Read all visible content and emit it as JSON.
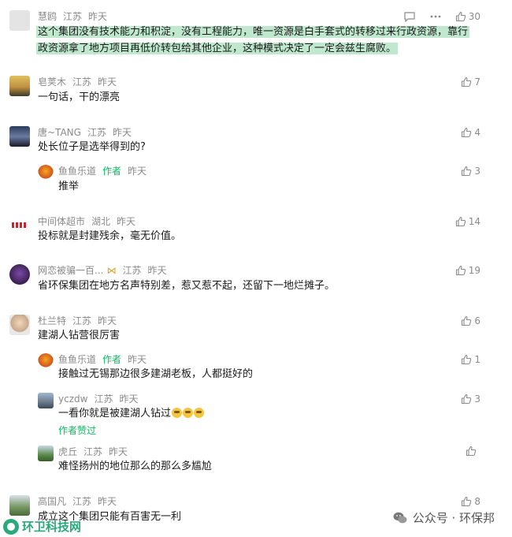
{
  "comments": [
    {
      "name": "慧鸥",
      "region": "江苏",
      "time": "昨天",
      "lines": [
        "这个集团没有技术能力和积淀，没有工程能力，唯一资源是白手套式的转移过来行政资源，靠行",
        "政资源拿了地方项目再低价转包给其他企业，这种模式决定了一定会兹生腐败。"
      ],
      "likes": "30"
    },
    {
      "name": "皂荚木",
      "region": "江苏",
      "time": "昨天",
      "text": "一句话，干的漂亮",
      "likes": "7"
    },
    {
      "name": "唐~TANG",
      "region": "江苏",
      "time": "昨天",
      "text": "处长位子是选举得到的?",
      "likes": "4"
    },
    {
      "name": "鱼鱼乐道",
      "tag": "作者",
      "time": "昨天",
      "text": "推举",
      "likes": "3"
    },
    {
      "name": "中间体超市",
      "region": "湖北",
      "time": "昨天",
      "text": "投标就是封建残余，毫无价值。",
      "likes": "14"
    },
    {
      "name": "网恋被骗一百...",
      "region": "江苏",
      "time": "昨天",
      "text": "省环保集团在地方名声特别差，惹又惹不起，还留下一地烂摊子。",
      "likes": "19"
    },
    {
      "name": "杜兰特",
      "region": "江苏",
      "time": "昨天",
      "text": "建湖人钻营很厉害",
      "likes": "6"
    },
    {
      "name": "鱼鱼乐道",
      "tag": "作者",
      "time": "昨天",
      "text": "接触过无锡那边很多建湖老板，人都挺好的",
      "likes": "1"
    },
    {
      "name": "yczdw",
      "region": "江苏",
      "time": "昨天",
      "text": "一看你就是被建湖人钻过",
      "sub": "作者赞过",
      "likes": "3"
    },
    {
      "name": "虎丘",
      "region": "江苏",
      "time": "昨天",
      "text": "难怪扬州的地位那么的那么多尴尬",
      "likes": ""
    },
    {
      "name": "高国凡",
      "region": "江苏",
      "time": "昨天",
      "text": "成立这个集团只能有百害无一利",
      "likes": "8"
    }
  ],
  "watermark": {
    "left": "环卫科技网",
    "right": "公众号 · 环保邦"
  },
  "colors": {
    "author": "#07c160",
    "highlight": "#bfe8cf",
    "meta": "#8a8a8a"
  }
}
